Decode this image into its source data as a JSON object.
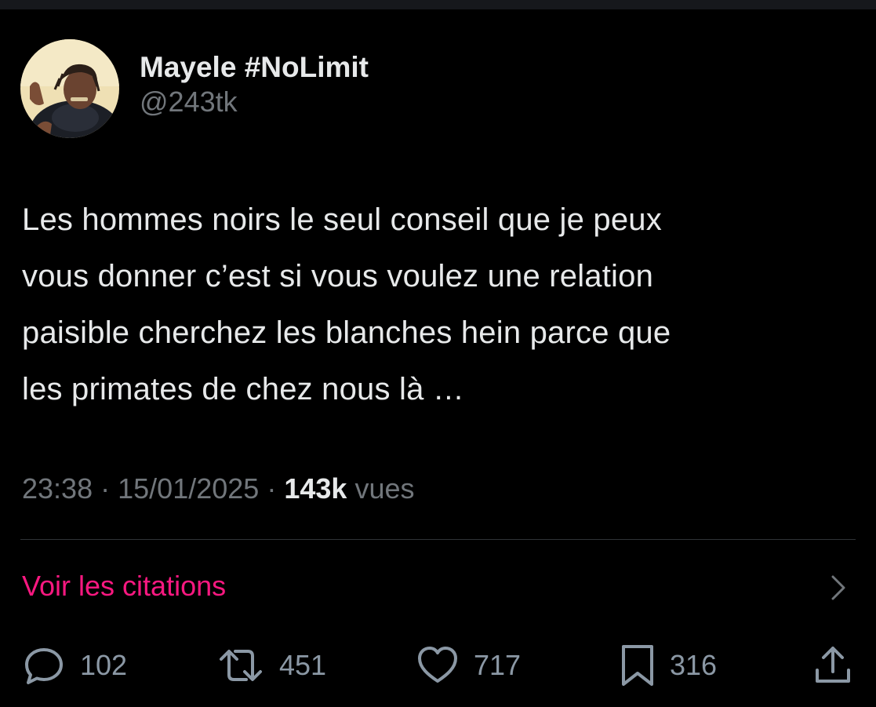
{
  "user": {
    "display_name": "Mayele #NoLimit",
    "handle": "@243tk"
  },
  "tweet": {
    "lines": [
      "Les hommes noirs le seul conseil que je peux",
      "vous donner c’est si vous voulez une relation",
      "paisible cherchez les blanches hein parce que",
      "les primates de chez nous là …"
    ],
    "time": "23:38",
    "separator": "·",
    "date": "15/01/2025",
    "views_count": "143k",
    "views_label": "vues"
  },
  "quotes_link": {
    "label": "Voir les citations"
  },
  "actions": {
    "replies": {
      "icon": "reply-icon",
      "count": "102"
    },
    "reposts": {
      "icon": "repost-icon",
      "count": "451"
    },
    "likes": {
      "icon": "heart-icon",
      "count": "717"
    },
    "bookmarks": {
      "icon": "bookmark-icon",
      "count": "316"
    },
    "share": {
      "icon": "share-icon"
    }
  },
  "colors": {
    "background": "#000000",
    "text": "#e7e9ea",
    "secondary_text": "#71767b",
    "accent_pink": "#f91880",
    "divider": "#2f3336"
  }
}
